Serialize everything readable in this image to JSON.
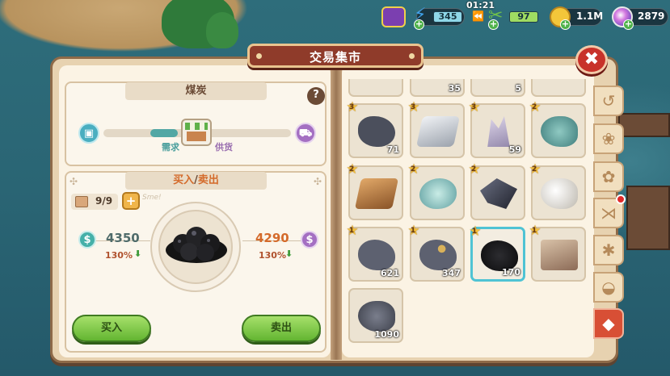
{
  "header": {
    "title": "交易集市"
  },
  "status": {
    "energy": "345",
    "timer": "01:21",
    "food": "97",
    "coins": "1.1M",
    "gems": "2879"
  },
  "detail": {
    "item_name": "煤炭",
    "help_icon": "?",
    "demand_label": "需求",
    "supply_label": "供货",
    "tab_buy_sell": [
      "买入",
      "/",
      "卖出"
    ],
    "capacity": "9/9",
    "sketch_text": "Sme!",
    "buy_price": "4350",
    "buy_percent": "130%",
    "sell_price": "4290",
    "sell_percent": "130%",
    "buy_button": "买入",
    "sell_button": "卖出"
  },
  "inventory": {
    "top_partial": [
      {
        "qty": ""
      },
      {
        "qty": "35"
      },
      {
        "qty": "5"
      },
      {
        "qty": ""
      }
    ],
    "items": [
      {
        "level": "3",
        "qty": "71",
        "ore": "dark-ore-icon"
      },
      {
        "level": "3",
        "qty": "",
        "ore": "silver-ingot-icon"
      },
      {
        "level": "3",
        "qty": "59",
        "ore": "crystal-icon"
      },
      {
        "level": "2",
        "qty": "",
        "ore": "teal-ore-icon"
      },
      {
        "level": "2",
        "qty": "",
        "ore": "bronze-ingot-icon"
      },
      {
        "level": "2",
        "qty": "",
        "ore": "jade-ore-icon"
      },
      {
        "level": "2",
        "qty": "",
        "ore": "obsidian-icon"
      },
      {
        "level": "2",
        "qty": "",
        "ore": "pearl-ore-icon"
      },
      {
        "level": "1",
        "qty": "621",
        "ore": "iron-ore-icon"
      },
      {
        "level": "1",
        "qty": "347",
        "ore": "gold-ore-icon"
      },
      {
        "level": "1",
        "qty": "170",
        "ore": "coal-icon"
      },
      {
        "level": "1",
        "qty": "",
        "ore": "stone-block-icon"
      },
      {
        "level": "",
        "qty": "1090",
        "ore": "gravel-icon"
      }
    ]
  },
  "tabs": [
    "history-icon",
    "shell-pile-icon",
    "cube-pile-icon",
    "fish-icon",
    "bug-icon",
    "shell-icon",
    "ore-tab-icon"
  ],
  "colors": {
    "accent_red": "#c8322a",
    "buy_price": "#4f6b6a",
    "sell_price": "#d46a2a",
    "percent_green": "#3e9b3a",
    "selected_border": "#4fc3d4"
  }
}
